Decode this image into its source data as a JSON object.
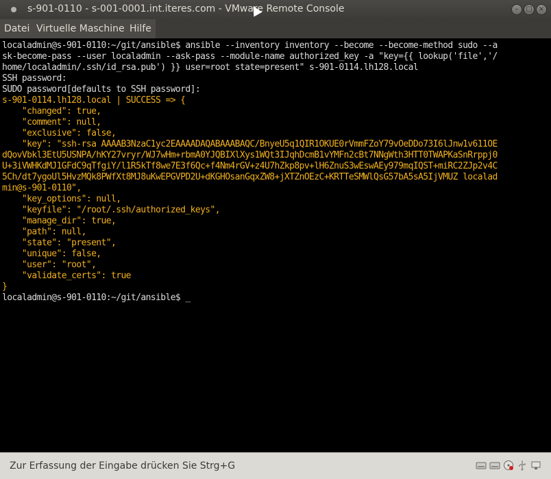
{
  "window": {
    "title": "s-901-0110 - s-001-0001.int.iteres.com - VMware Remote Console"
  },
  "menubar": {
    "items": [
      "Datei",
      "Virtuelle Maschine",
      "Hilfe"
    ]
  },
  "terminal": {
    "lines": [
      "localadmin@s-901-0110:~/git/ansible$ ansible --inventory inventory --become --become-method sudo --a",
      "sk-become-pass --user localadmin --ask-pass --module-name authorized_key -a \"key={{ lookup('file','/",
      "home/localadmin/.ssh/id_rsa.pub') }} user=root state=present\" s-901-0114.lh128.local",
      "SSH password:",
      "SUDO password[defaults to SSH password]:",
      "s-901-0114.lh128.local | SUCCESS => {",
      "    \"changed\": true,",
      "    \"comment\": null,",
      "    \"exclusive\": false,",
      "    \"key\": \"ssh-rsa AAAAB3NzaC1yc2EAAAADAQABAAABAQC/BnyeU5q1QIR1OKUE0rVmmFZoY79vOeDDo73I6lJnw1v611OE",
      "dQovVbkl3EtU5USNPA/hKY27vryr/WJ7wHm+rbmA0YJQBIXlXys1WQt3IJqhDcmB1vYMFn2cBt7NNgWth3HTT0TWAPKaSnRrppj0",
      "U+3iVWHKdMJ1GFdC9qTfgiY/l1R5kTf8we7E3f6Qc+f4Nm4rGV+z4U7hZkp8pv+lH6ZnuS3wEswAEy979mqIQST+miRC2ZJp2v4C",
      "5Ch/dt7ygoUl5HvzMQk8PWfXt8MJ8uKwEPGVPD2U+dKGHOsanGqxZW8+jXTZnOEzC+KRTTeSMWlQsG57bA5sA5IjVMUZ localad",
      "min@s-901-0110\",",
      "    \"key_options\": null,",
      "    \"keyfile\": \"/root/.ssh/authorized_keys\",",
      "    \"manage_dir\": true,",
      "    \"path\": null,",
      "    \"state\": \"present\",",
      "    \"unique\": false,",
      "    \"user\": \"root\",",
      "    \"validate_certs\": true",
      "}",
      "localadmin@s-901-0110:~/git/ansible$ _"
    ]
  },
  "statusbar": {
    "text": "Zur Erfassung der Eingabe drücken Sie Strg+G"
  },
  "colors": {
    "terminal_text": "#dcdcdc",
    "ansible_success": "#f0b020",
    "terminal_bg": "#000000"
  }
}
